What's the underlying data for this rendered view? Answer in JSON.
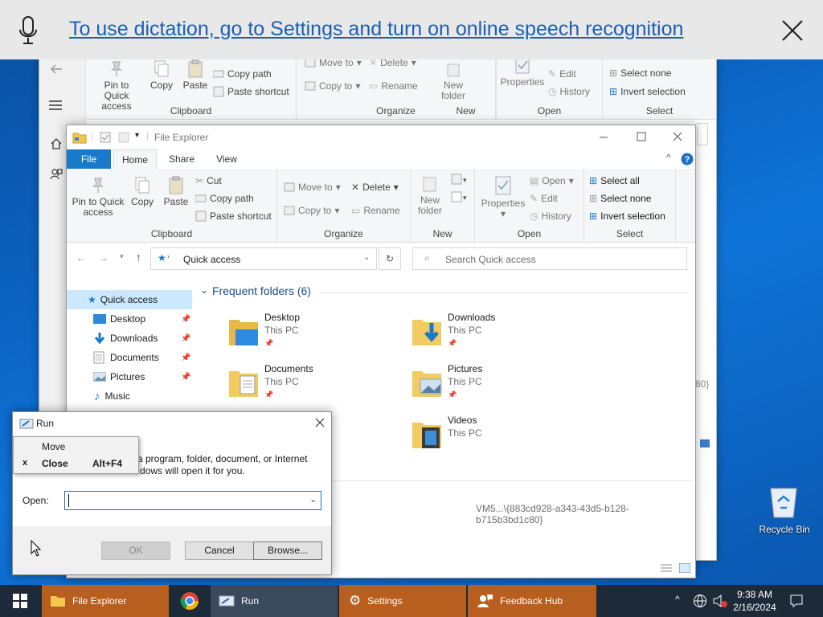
{
  "banner": {
    "text": "To use dictation, go to Settings and turn on online speech recognition"
  },
  "back_explorer": {
    "ribbon": {
      "pin": "Pin to Quick access",
      "copy": "Copy",
      "paste": "Paste",
      "copy_path": "Copy path",
      "paste_shortcut": "Paste shortcut",
      "move_to": "Move to",
      "delete": "Delete",
      "copy_to": "Copy to",
      "rename": "Rename",
      "new_folder": "New folder",
      "properties": "Properties",
      "edit": "Edit",
      "history": "History",
      "select_none": "Select none",
      "invert_selection": "Invert selection",
      "groups": [
        "Clipboard",
        "Organize",
        "New",
        "Open",
        "Select"
      ]
    },
    "path_fragment": "80}"
  },
  "explorer": {
    "title": "File Explorer",
    "tabs": [
      "File",
      "Home",
      "Share",
      "View"
    ],
    "ribbon": {
      "pin": "Pin to Quick access",
      "copy": "Copy",
      "paste": "Paste",
      "cut": "Cut",
      "copy_path": "Copy path",
      "paste_shortcut": "Paste shortcut",
      "move_to": "Move to",
      "delete": "Delete",
      "copy_to": "Copy to",
      "rename": "Rename",
      "new_folder": "New folder",
      "properties": "Properties",
      "open": "Open",
      "edit": "Edit",
      "history": "History",
      "select_all": "Select all",
      "select_none": "Select none",
      "invert_selection": "Invert selection",
      "groups": [
        "Clipboard",
        "Organize",
        "New",
        "Open",
        "Select"
      ]
    },
    "address": "Quick access",
    "search_placeholder": "Search Quick access",
    "nav": [
      "Quick access",
      "Desktop",
      "Downloads",
      "Documents",
      "Pictures",
      "Music"
    ],
    "section_title": "Frequent folders (6)",
    "folders": [
      {
        "name": "Desktop",
        "sub": "This PC"
      },
      {
        "name": "Downloads",
        "sub": "This PC"
      },
      {
        "name": "Documents",
        "sub": "This PC"
      },
      {
        "name": "Pictures",
        "sub": "This PC"
      },
      {
        "name": "Videos",
        "sub": "This PC"
      }
    ],
    "status_path": "VM5...\\{883cd928-a343-43d5-b128-b715b3bd1c80}"
  },
  "run": {
    "title": "Run",
    "desc_line1": "a program, folder, document, or Internet",
    "desc_line2": "dows will open it for you.",
    "open_label": "Open:",
    "open_value": "",
    "ok": "OK",
    "cancel": "Cancel",
    "browse": "Browse..."
  },
  "context_menu": {
    "move": "Move",
    "close_mark": "x",
    "close": "Close",
    "close_shortcut": "Alt+F4"
  },
  "desktop": {
    "recycle_bin": "Recycle Bin"
  },
  "taskbar": {
    "items": [
      "File Explorer",
      "Run",
      "Settings",
      "Feedback Hub"
    ],
    "time": "9:38 AM",
    "date": "2/16/2024"
  }
}
